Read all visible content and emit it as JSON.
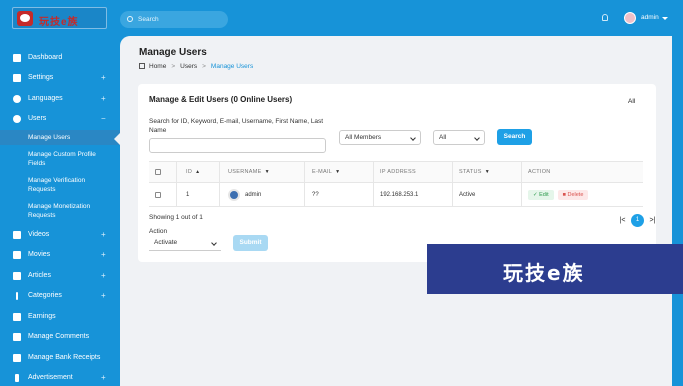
{
  "topbar": {
    "logo_text": "玩技e族",
    "search_placeholder": "Search",
    "user_name": "admin"
  },
  "sidebar": {
    "items": [
      {
        "label": "Dashboard",
        "icon": "dashboard-icon",
        "plus": ""
      },
      {
        "label": "Settings",
        "icon": "gear-icon",
        "plus": "+"
      },
      {
        "label": "Languages",
        "icon": "globe-icon",
        "plus": "+"
      },
      {
        "label": "Users",
        "icon": "user-icon",
        "plus": "−"
      },
      {
        "label": "Videos",
        "icon": "video-icon",
        "plus": "+"
      },
      {
        "label": "Movies",
        "icon": "film-icon",
        "plus": "+"
      },
      {
        "label": "Articles",
        "icon": "article-icon",
        "plus": "+"
      },
      {
        "label": "Categories",
        "icon": "dots-icon",
        "plus": "+"
      },
      {
        "label": "Earnings",
        "icon": "money-icon",
        "plus": ""
      },
      {
        "label": "Manage Comments",
        "icon": "comment-icon",
        "plus": ""
      },
      {
        "label": "Manage Bank Receipts",
        "icon": "receipt-icon",
        "plus": ""
      },
      {
        "label": "Advertisement",
        "icon": "dollar-icon",
        "plus": "+"
      }
    ],
    "subitems": [
      "Manage Users",
      "Manage Custom Profile Fields",
      "Manage Verification Requests",
      "Manage Monetization Requests"
    ]
  },
  "page": {
    "title": "Manage Users",
    "breadcrumb": [
      "Home",
      "Users",
      "Manage Users"
    ]
  },
  "card": {
    "title": "Manage & Edit Users (0 Online Users)",
    "all_label": "All",
    "search_label": "Search for ID, Keyword, E-mail, Username, First Name, Last Name",
    "members_select": "All Members",
    "status_select": "All",
    "search_button": "Search",
    "columns": [
      "ID",
      "USERNAME",
      "E-MAIL",
      "IP ADDRESS",
      "STATUS",
      "ACTION"
    ],
    "rows": [
      {
        "id": "1",
        "username": "admin",
        "email": "??",
        "ip": "192.168.253.1",
        "status": "Active",
        "edit": "Edit",
        "delete": "Delete"
      }
    ],
    "showing": "Showing 1 out of 1",
    "pager": {
      "first": "|<",
      "current": "1",
      "last": ">|"
    },
    "action_label": "Action",
    "action_select": "Activate",
    "submit_button": "Submit"
  },
  "watermark": "玩技e族",
  "colors": {
    "primary": "#1793d8",
    "button": "#1ea0e6",
    "edit": "#2c9a4b",
    "delete": "#d9534f"
  }
}
